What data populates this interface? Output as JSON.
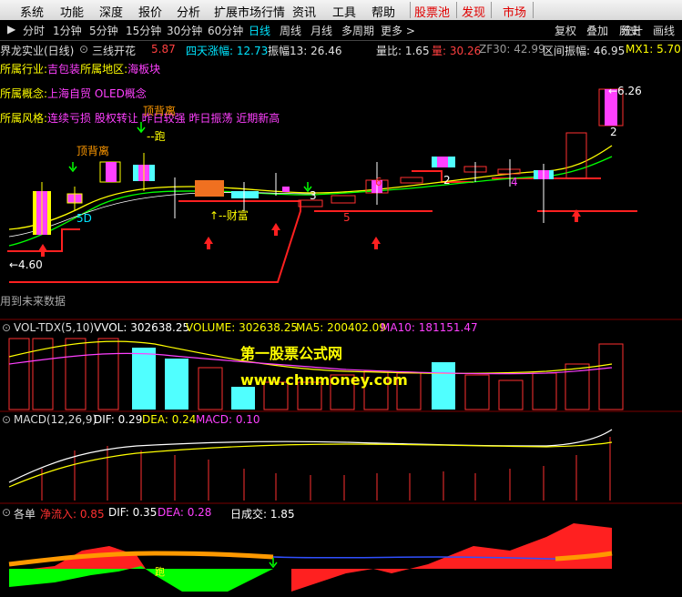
{
  "menubar": {
    "items": [
      "系统",
      "功能",
      "深度",
      "报价",
      "分析",
      "扩展市场行情",
      "资讯",
      "工具",
      "帮助"
    ],
    "hot_items": [
      "股票池",
      "发现",
      "市场"
    ]
  },
  "toolbar": {
    "periods": [
      "分时",
      "1分钟",
      "5分钟",
      "15分钟",
      "30分钟",
      "60分钟",
      "日线",
      "周线",
      "月线",
      "多周期",
      "更多 >"
    ],
    "active_period": "日线",
    "right_buttons": [
      "复权",
      "叠加",
      "历史",
      "统计",
      "画线"
    ]
  },
  "main_panel": {
    "title": "界龙实业(日线)",
    "indicator_name": "三线开花",
    "indicator_value": "5.87",
    "stats": [
      {
        "label": "四天涨幅: ",
        "value": "12.73",
        "color": "#00e5ff"
      },
      {
        "label": "振幅13: ",
        "value": "26.46",
        "color": "#e0e0e0"
      }
    ],
    "right_stats": [
      {
        "label": "量比: ",
        "value": "1.65",
        "color": "#e0e0e0"
      },
      {
        "label": "量: ",
        "value": "30.26",
        "color": "#ff4040"
      },
      {
        "label": "ZF30: ",
        "value": "42.99",
        "color": "#9a9a9a"
      },
      {
        "label": "区间振幅: ",
        "value": "46.95",
        "color": "#e0e0e0"
      },
      {
        "label": "MX1: ",
        "value": "5.70",
        "color": "#ffff00"
      }
    ],
    "info_lines": [
      {
        "label": "所属行业:",
        "value": "吉包装",
        "label2": "所属地区:",
        "value2": "海板块"
      },
      {
        "label": "所属概念:",
        "value": "上海自贸 OLED概念"
      },
      {
        "label": "所属风格:",
        "value": "连续亏损 股权转让 昨日较强 昨日振荡 近期新高"
      }
    ],
    "annotations": {
      "top_divergence_1": "顶背离",
      "top_divergence_2": "顶背离",
      "run": "跑",
      "fortune": "↑--财富",
      "low_price": "←4.60",
      "high_price": "←6.26",
      "n5_a": "5",
      "n5_b": "5",
      "n2_a": "2",
      "n2_b": "2",
      "n4": "4",
      "n6": "6",
      "n3": "3",
      "n5d": "5D"
    },
    "future_data_note": "用到未来数据"
  },
  "vol_panel": {
    "header": "VOL-TDX(5,10)",
    "items": [
      {
        "label": "VVOL: ",
        "value": "302638.25",
        "color": "#ffffff"
      },
      {
        "label": "VOLUME: ",
        "value": "302638.25",
        "color": "#ffff00"
      },
      {
        "label": "MA5: ",
        "value": "200402.09",
        "color": "#ffff00"
      },
      {
        "label": "MA10: ",
        "value": "181151.47",
        "color": "#ff40ff"
      }
    ],
    "watermark_cn": "第一股票公式网",
    "watermark_url": "www.chnmoney.com"
  },
  "macd_panel": {
    "header": "MACD(12,26,9)",
    "items": [
      {
        "label": "DIF: ",
        "value": "0.29",
        "color": "#ffffff"
      },
      {
        "label": "DEA: ",
        "value": "0.24",
        "color": "#ffff00"
      },
      {
        "label": "MACD: ",
        "value": "0.10",
        "color": "#ff40ff"
      }
    ]
  },
  "order_panel": {
    "header": "各单",
    "items": [
      {
        "label": "净流入: ",
        "value": "0.85",
        "color": "#ff3030"
      },
      {
        "label": "DIF: ",
        "value": "0.35",
        "color": "#ffffff"
      },
      {
        "label": "DEA: ",
        "value": "0.28",
        "color": "#ff40ff"
      },
      {
        "label": "日成交: ",
        "value": "1.85",
        "color": "#ffffff"
      }
    ],
    "run_label": "跑"
  },
  "colors": {
    "up": "#ff3030",
    "down": "#50ffff",
    "magenta": "#ff40ff",
    "yellow": "#ffff00",
    "green": "#00ff00"
  }
}
